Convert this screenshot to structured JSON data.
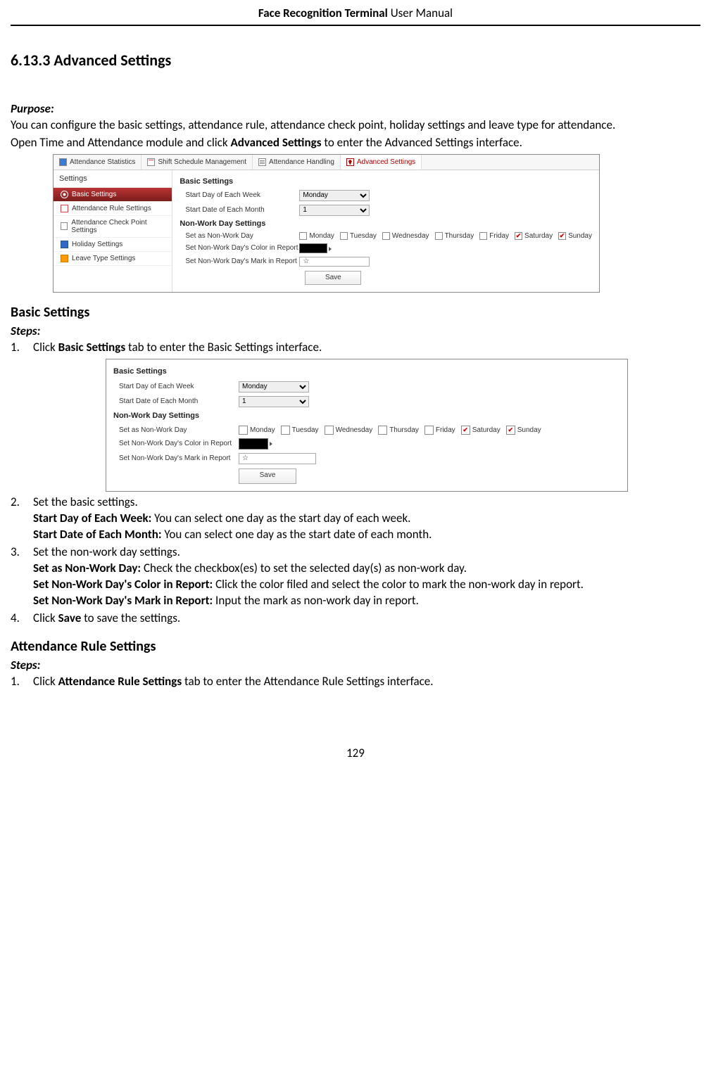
{
  "header_bold": "Face Recognition Terminal",
  "header_rest": "  User Manual",
  "heading": "6.13.3 Advanced Settings",
  "purpose_label": "Purpose:",
  "purpose_p1": "You can configure the basic settings, attendance rule, attendance check point, holiday settings and leave type for attendance.",
  "purpose_p2a": "Open Time and Attendance module and click ",
  "purpose_p2b": "Advanced Settings",
  "purpose_p2c": " to enter the Advanced Settings interface.",
  "fig1": {
    "tabs": [
      "Attendance Statistics",
      "Shift Schedule Management",
      "Attendance Handling",
      "Advanced Settings"
    ],
    "sidebar_title": "Settings",
    "sidebar": [
      "Basic Settings",
      "Attendance Rule Settings",
      "Attendance Check Point Settings",
      "Holiday Settings",
      "Leave Type Settings"
    ],
    "grp1": "Basic Settings",
    "row1_label": "Start Day of Each Week",
    "row1_value": "Monday",
    "row2_label": "Start Date of Each Month",
    "row2_value": "1",
    "grp2": "Non-Work Day Settings",
    "row3_label": "Set as Non-Work Day",
    "days": [
      "Monday",
      "Tuesday",
      "Wednesday",
      "Thursday",
      "Friday",
      "Saturday",
      "Sunday"
    ],
    "days_checked": [
      false,
      false,
      false,
      false,
      false,
      true,
      true
    ],
    "row4_label": "Set Non-Work Day's Color in Report",
    "row5_label": "Set Non-Work Day's Mark in Report",
    "row5_value": "☆",
    "save": "Save"
  },
  "sec_basic": "Basic Settings",
  "steps_label": "Steps:",
  "bs1a": "Click ",
  "bs1b": "Basic Settings",
  "bs1c": " tab to enter the Basic Settings interface.",
  "bs2": "Set the basic settings.",
  "bs2_d1b": "Start Day of Each Week:",
  "bs2_d1t": " You can select one day as the start day of each week.",
  "bs2_d2b": "Start Date of Each Month:",
  "bs2_d2t": " You can select one day as the start date of each month.",
  "bs3": "Set the non-work day settings.",
  "bs3_d1b": "Set as Non-Work Day:",
  "bs3_d1t": " Check the checkbox(es) to set the selected day(s) as non-work day.",
  "bs3_d2b": "Set Non-Work Day's Color in Report:",
  "bs3_d2t": " Click the color filed and select the color to mark the non-work day in report.",
  "bs3_d3b": "Set Non-Work Day's Mark in Report:",
  "bs3_d3t": " Input the mark as non-work day in report.",
  "bs4a": "Click ",
  "bs4b": "Save",
  "bs4c": " to save the settings.",
  "sec_rule": "Attendance Rule Settings",
  "ar1a": "Click ",
  "ar1b": "Attendance Rule Settings",
  "ar1c": " tab to enter the Attendance Rule Settings interface.",
  "page_number": "129"
}
